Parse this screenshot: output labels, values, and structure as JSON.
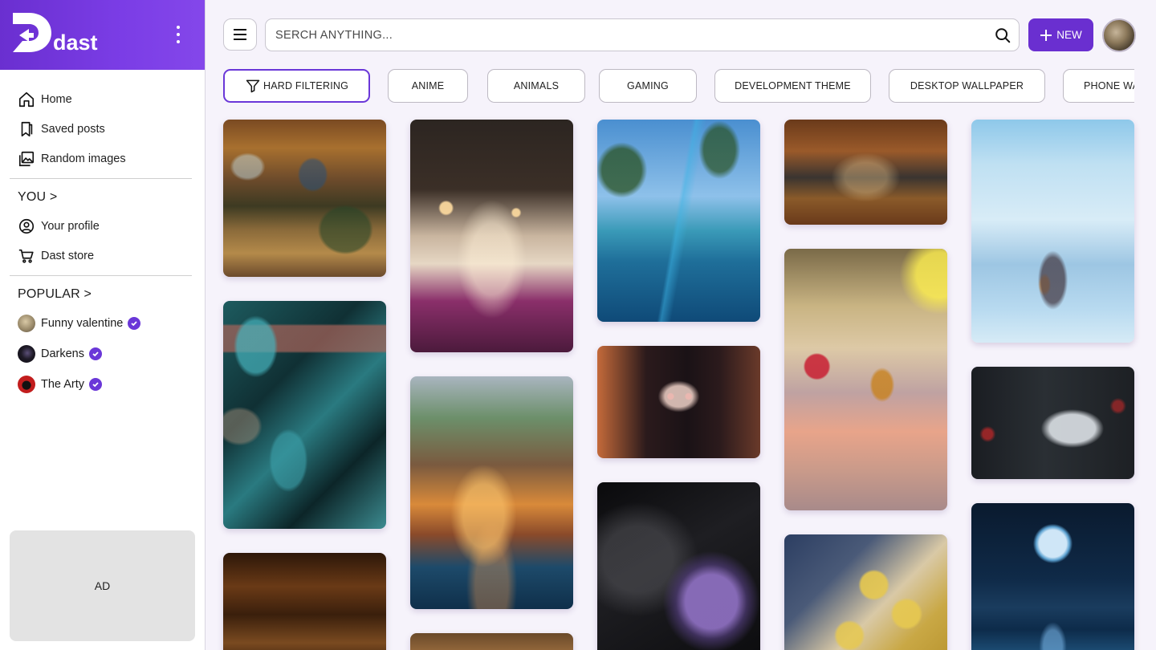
{
  "brand": {
    "name": "dast"
  },
  "nav": {
    "home": "Home",
    "saved": "Saved posts",
    "random": "Random images"
  },
  "you": {
    "title": "YOU >",
    "profile": "Your profile",
    "store": "Dast store"
  },
  "popular": {
    "title": "POPULAR >",
    "items": [
      {
        "name": "Funny valentine",
        "color": "#9a8a6a"
      },
      {
        "name": "Darkens",
        "color": "#1e1a26"
      },
      {
        "name": "The Arty",
        "color": "#c21d1d"
      }
    ]
  },
  "ad": {
    "label": "AD"
  },
  "search": {
    "placeholder": "SERCH ANYTHING..."
  },
  "new_button": {
    "label": "NEW"
  },
  "filters": {
    "hard": "HARD FILTERING",
    "chips": [
      "ANIME",
      "ANIMALS",
      "GAMING",
      "DEVELOPMENT THEME",
      "DESKTOP WALLPAPER",
      "PHONE WA"
    ]
  },
  "colors": {
    "accent": "#6a2fd0",
    "verified": "#6a37d8"
  },
  "gallery": [
    {
      "subject": "cabin-interior"
    },
    {
      "subject": "teal-stones"
    },
    {
      "subject": "wood-texture"
    },
    {
      "subject": "lounge-interior"
    },
    {
      "subject": "tropical-pavilion"
    },
    {
      "subject": "rustic-cabin"
    },
    {
      "subject": "infinity-pool-palms"
    },
    {
      "subject": "anime-girl-red-eyes"
    },
    {
      "subject": "abstract-purple-shape"
    },
    {
      "subject": "wooden-kitchen"
    },
    {
      "subject": "cocktail-bar"
    },
    {
      "subject": "golden-curls-manga"
    },
    {
      "subject": "snowy-cabin"
    },
    {
      "subject": "anime-girl-headphones"
    },
    {
      "subject": "moon-over-lake"
    }
  ]
}
